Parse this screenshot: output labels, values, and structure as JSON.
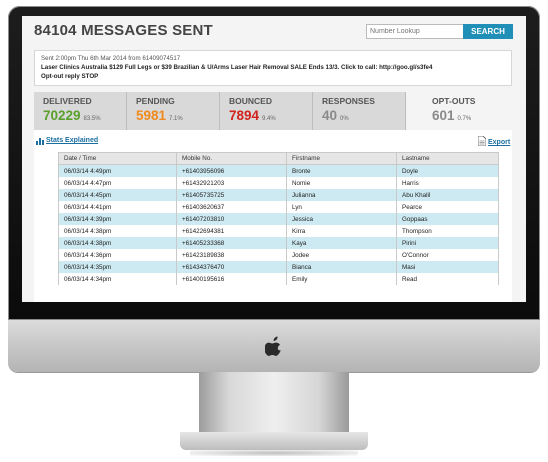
{
  "header": {
    "title": "84104 MESSAGES SENT",
    "search_placeholder": "Number Lookup",
    "search_button": "SEARCH"
  },
  "message": {
    "sent_line": "Sent 2:00pm Thu 6th Mar 2014 from 61409074517",
    "body": "Laser Clinics Australia $129 Full Legs or $39 Brazilian & U/Arms Laser Hair Removal SALE Ends 13/3. Click to call: http://goo.gl/s3fe4",
    "optout": "Opt-out reply STOP"
  },
  "stats": [
    {
      "label": "DELIVERED",
      "value": "70229",
      "pct": "83.5%",
      "color": "#5aa02c"
    },
    {
      "label": "PENDING",
      "value": "5981",
      "pct": "7.1%",
      "color": "#f08a1c"
    },
    {
      "label": "BOUNCED",
      "value": "7894",
      "pct": "9.4%",
      "color": "#d2231c"
    },
    {
      "label": "RESPONSES",
      "value": "40",
      "pct": "0%",
      "color": "#8a8a8a"
    },
    {
      "label": "OPT-OUTS",
      "value": "601",
      "pct": "0.7%",
      "color": "#8a8a8a"
    }
  ],
  "links": {
    "stats_explained": "Stats Explained",
    "export": "Export"
  },
  "table": {
    "headers": [
      "Date / Time",
      "Mobile No.",
      "Firstname",
      "Lastname"
    ],
    "rows": [
      [
        "06/03/14 4:49pm",
        "+61403956096",
        "Bronte",
        "Doyle"
      ],
      [
        "06/03/14 4:47pm",
        "+61432921203",
        "Nomie",
        "Harris"
      ],
      [
        "06/03/14 4:45pm",
        "+61405735725",
        "Julianna",
        "Abu Khalil"
      ],
      [
        "06/03/14 4:41pm",
        "+61403620637",
        "Lyn",
        "Pearce"
      ],
      [
        "06/03/14 4:39pm",
        "+61407203810",
        "Jessica",
        "Goppaas"
      ],
      [
        "06/03/14 4:38pm",
        "+61422694381",
        "Kirra",
        "Thompson"
      ],
      [
        "06/03/14 4:38pm",
        "+61405233368",
        "Kaya",
        "Pirini"
      ],
      [
        "06/03/14 4:36pm",
        "+61423189838",
        "Jodee",
        "O'Connor"
      ],
      [
        "06/03/14 4:35pm",
        "+61434376470",
        "Bianca",
        "Masi"
      ],
      [
        "06/03/14 4:34pm",
        "+61400195616",
        "Emily",
        "Read"
      ]
    ]
  },
  "icons": {
    "chin_logo": "apple-logo-icon",
    "stats": "bar-chart-icon",
    "export": "export-file-icon"
  }
}
